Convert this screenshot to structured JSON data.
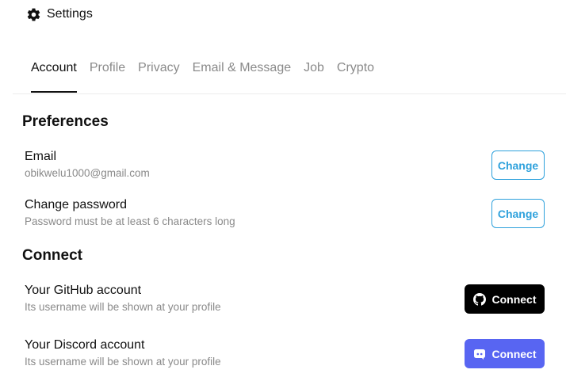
{
  "header": {
    "icon": "gear-icon",
    "title": "Settings"
  },
  "tabs": [
    {
      "label": "Account",
      "active": true
    },
    {
      "label": "Profile",
      "active": false
    },
    {
      "label": "Privacy",
      "active": false
    },
    {
      "label": "Email & Message",
      "active": false
    },
    {
      "label": "Job",
      "active": false
    },
    {
      "label": "Crypto",
      "active": false
    }
  ],
  "preferences": {
    "title": "Preferences",
    "email": {
      "label": "Email",
      "value": "obikwelu1000@gmail.com",
      "button": "Change"
    },
    "password": {
      "label": "Change password",
      "hint": "Password must be at least 6 characters long",
      "button": "Change"
    }
  },
  "connect": {
    "title": "Connect",
    "github": {
      "label": "Your GitHub account",
      "hint": "Its username will be shown at your profile",
      "button": "Connect",
      "icon": "github-icon",
      "color": "#000000"
    },
    "discord": {
      "label": "Your Discord account",
      "hint": "Its username will be shown at your profile",
      "button": "Connect",
      "icon": "discord-icon",
      "color": "#5865f2"
    }
  },
  "colors": {
    "accent": "#2ea1dc",
    "muted_text": "#8a8a8a"
  }
}
